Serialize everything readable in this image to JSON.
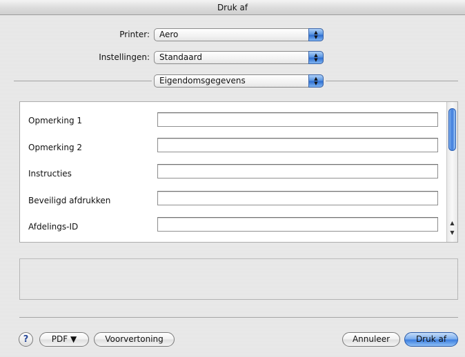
{
  "window": {
    "title": "Druk af"
  },
  "printer": {
    "label": "Printer:",
    "value": "Aero"
  },
  "settings": {
    "label": "Instellingen:",
    "value": "Standaard"
  },
  "pane_selector": {
    "value": "Eigendomsgegevens"
  },
  "fields": [
    {
      "label": "Opmerking 1",
      "value": ""
    },
    {
      "label": "Opmerking 2",
      "value": ""
    },
    {
      "label": "Instructies",
      "value": ""
    },
    {
      "label": "Beveiligd afdrukken",
      "value": ""
    },
    {
      "label": "Afdelings-ID",
      "value": ""
    }
  ],
  "buttons": {
    "help": "?",
    "pdf": "PDF ▼",
    "preview": "Voorvertoning",
    "cancel": "Annuleer",
    "print": "Druk af"
  },
  "colors": {
    "accent": "#3d7fdf"
  }
}
